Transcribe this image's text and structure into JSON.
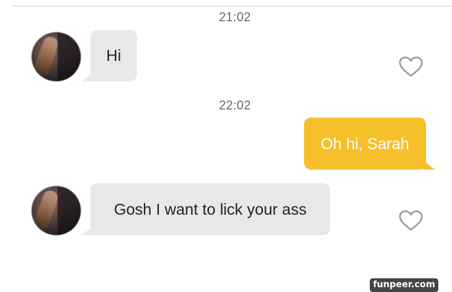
{
  "conversation": {
    "messages": [
      {
        "timestamp": "21:02",
        "direction": "incoming",
        "text": "Hi",
        "like_icon": "heart-outline-icon"
      },
      {
        "timestamp": "22:02",
        "direction": "outgoing",
        "text": "Oh hi, Sarah"
      },
      {
        "direction": "incoming",
        "text": "Gosh I want to lick your ass",
        "like_icon": "heart-outline-icon"
      }
    ]
  },
  "watermark": {
    "text": "funpeer.com"
  },
  "colors": {
    "incoming_bubble": "#e8e8e8",
    "outgoing_bubble": "#f5c02a",
    "outgoing_text": "#ffffff",
    "timestamp_text": "#666666",
    "heart_outline": "#9a9a9a"
  }
}
